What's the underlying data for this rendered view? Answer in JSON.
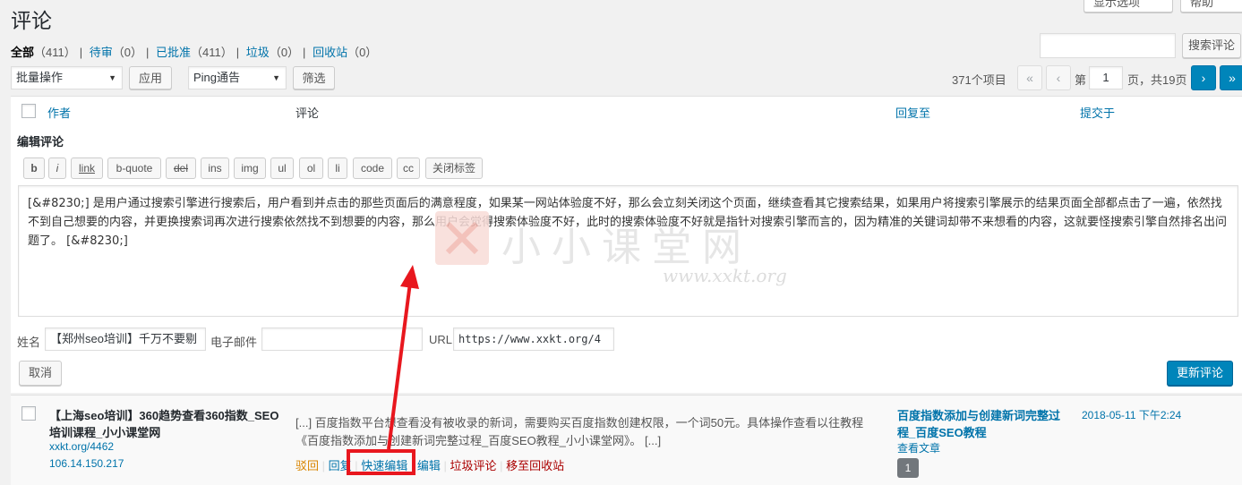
{
  "page": {
    "title": "评论"
  },
  "top_buttons": {
    "screen_options": "显示选项",
    "help": "帮助"
  },
  "filters": {
    "all": {
      "label": "全部",
      "count": "（411）"
    },
    "pending": {
      "label": "待审",
      "count": "（0）"
    },
    "approved": {
      "label": "已批准",
      "count": "（411）"
    },
    "spam": {
      "label": "垃圾",
      "count": "（0）"
    },
    "trash": {
      "label": "回收站",
      "count": "（0）"
    }
  },
  "search": {
    "button": "搜索评论"
  },
  "bulk": {
    "selected": "批量操作",
    "apply": "应用"
  },
  "type_filter": {
    "selected": "Ping通告",
    "button": "筛选"
  },
  "pagination": {
    "items": "371个项目",
    "first": "«",
    "prev": "‹",
    "page_prefix": "第",
    "current": "1",
    "page_suffix": "页，共19页",
    "next": "›",
    "last": "»"
  },
  "columns": {
    "author": "作者",
    "comment": "评论",
    "response": "回复至",
    "submitted": "提交于"
  },
  "editor": {
    "heading": "编辑评论",
    "quicktags": [
      "b",
      "i",
      "link",
      "b-quote",
      "del",
      "ins",
      "img",
      "ul",
      "ol",
      "li",
      "code",
      "cc",
      "关闭标签"
    ],
    "content": "[&#8230;] 是用户通过搜索引擎进行搜索后，用户看到并点击的那些页面后的满意程度，如果某一网站体验度不好，那么会立刻关闭这个页面，继续查看其它搜索结果，如果用户将搜索引擎展示的结果页面全部都点击了一遍，依然找不到自己想要的内容，并更换搜索词再次进行搜索依然找不到想要的内容，那么用户会觉得搜索体验度不好，此时的搜索体验度不好就是指针对搜索引擎而言的，因为精准的关键词却带不来想看的内容，这就要怪搜索引擎自然排名出问题了。 [&#8230;]",
    "name_label": "姓名",
    "name_value": "【郑州seo培训】千万不要剔",
    "email_label": "电子邮件",
    "email_value": "",
    "url_label": "URL",
    "url_value": "https://www.xxkt.org/4",
    "cancel": "取消",
    "update": "更新评论"
  },
  "watermark": {
    "text": "小小课堂网",
    "url": "www.xxkt.org"
  },
  "comment_row": {
    "author_name_1": "【上海seo培训】360趋势查看360指数_SEO",
    "author_name_2": "培训课程_小小课堂网",
    "author_url": "xxkt.org/4462",
    "author_ip": "106.14.150.217",
    "text_1": "[...] 百度指数平台想查看没有被收录的新词，需要购买百度指数创建权限，一个词50元。具体操作查看以往教程",
    "text_2": "《百度指数添加与创建新词完整过程_百度SEO教程_小小课堂网》。 [...]",
    "actions": {
      "unapprove": "驳回",
      "reply": "回复",
      "quick_edit": "快速编辑",
      "edit": "编辑",
      "spam": "垃圾评论",
      "trash": "移至回收站"
    },
    "response_title_1": "百度指数添加与创建新词完整过",
    "response_title_2": "程_百度SEO教程",
    "view_post": "查看文章",
    "comment_count": "1",
    "date": "2018-05-11 下午2:24"
  },
  "colors": {
    "accent": "#0073aa",
    "primary": "#0085ba",
    "annotation": "#e8171e"
  }
}
